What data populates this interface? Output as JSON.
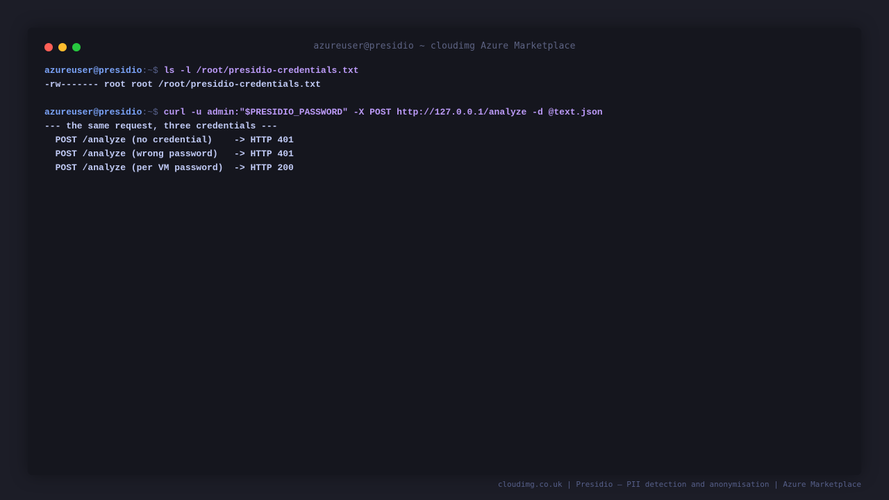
{
  "window": {
    "title": "azureuser@presidio ~ cloudimg Azure Marketplace"
  },
  "colors": {
    "prompt_user": "#7aa2f7",
    "prompt_sep": "#565f89",
    "command": "#bb9af7",
    "output": "#c0caf5",
    "close_dot": "#ff5f56",
    "minimize_dot": "#ffbd2e",
    "maximize_dot": "#27c93f"
  },
  "terminal": {
    "prompt_user": "azureuser@presidio",
    "prompt_sep": ":~$",
    "cmd1": "ls -l /root/presidio-credentials.txt",
    "out1": "-rw------- root root /root/presidio-credentials.txt",
    "cmd2": "curl -u admin:\"$PRESIDIO_PASSWORD\" -X POST http://127.0.0.1/analyze -d @text.json",
    "out2": [
      "--- the same request, three credentials ---",
      "  POST /analyze (no credential)    -> HTTP 401",
      "  POST /analyze (wrong password)   -> HTTP 401",
      "  POST /analyze (per VM password)  -> HTTP 200"
    ]
  },
  "footer": {
    "text": "cloudimg.co.uk | Presidio — PII detection and anonymisation | Azure Marketplace"
  }
}
